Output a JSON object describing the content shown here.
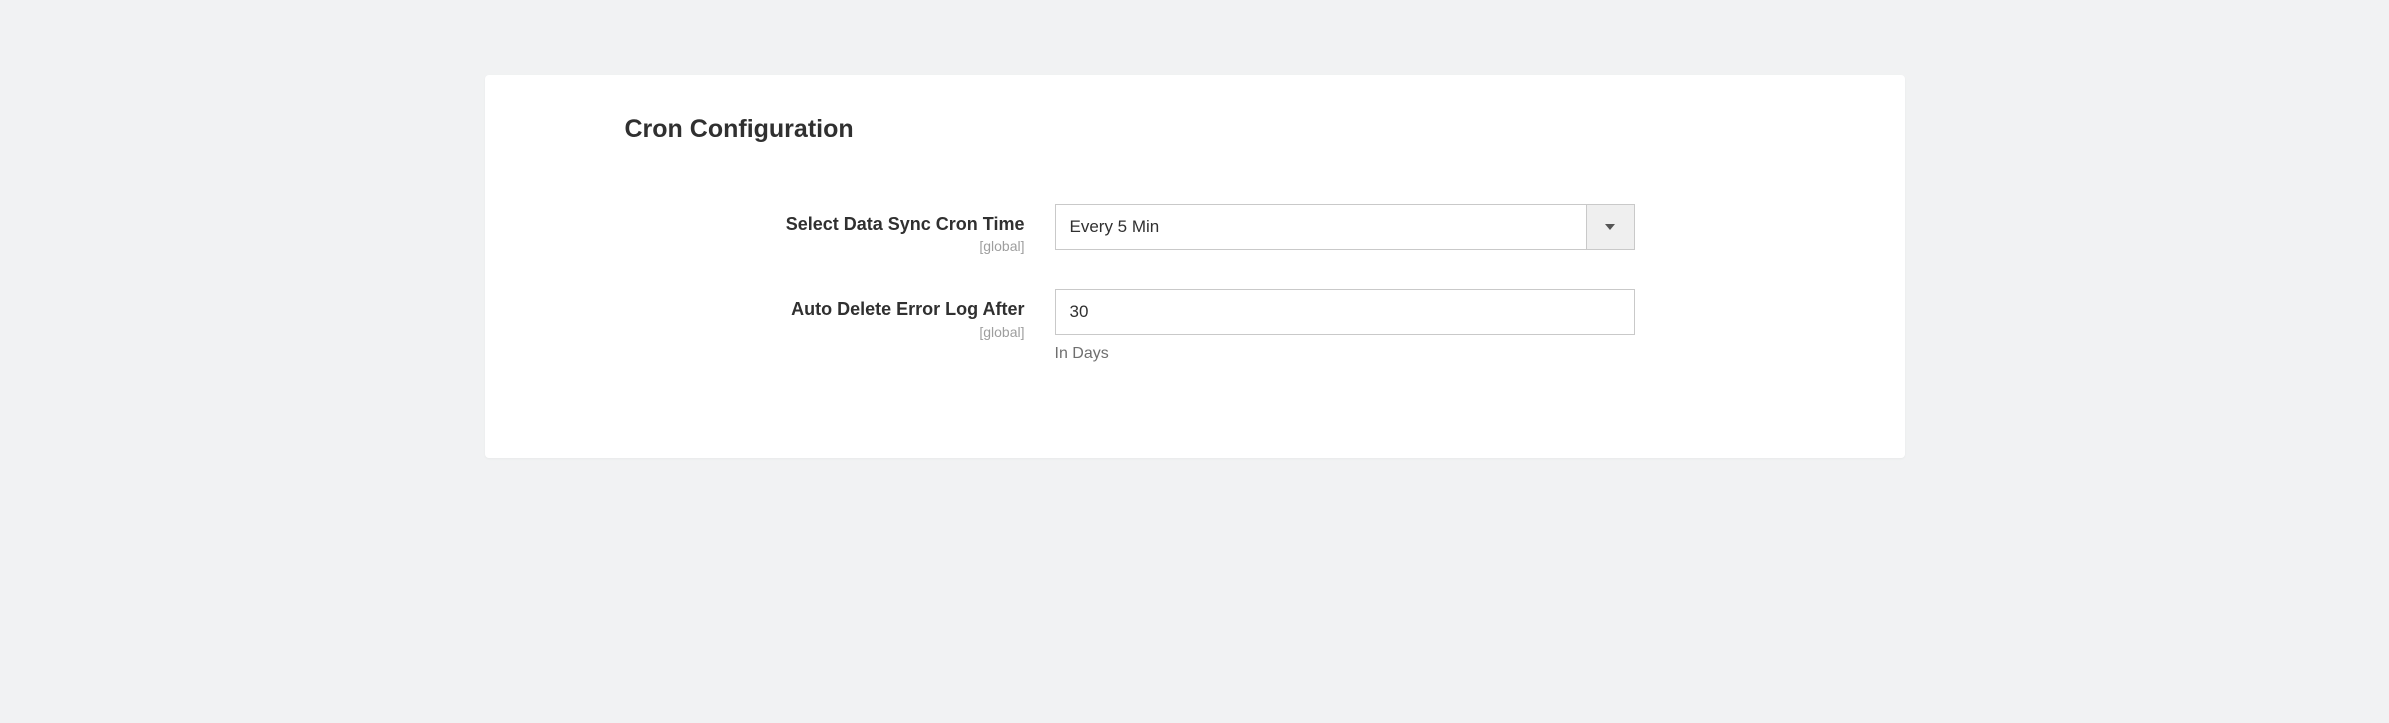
{
  "section": {
    "title": "Cron Configuration"
  },
  "fields": {
    "cronTime": {
      "label": "Select Data Sync Cron Time",
      "scope": "[global]",
      "value": "Every 5 Min"
    },
    "autoDelete": {
      "label": "Auto Delete Error Log After",
      "scope": "[global]",
      "value": "30",
      "help": "In Days"
    }
  }
}
